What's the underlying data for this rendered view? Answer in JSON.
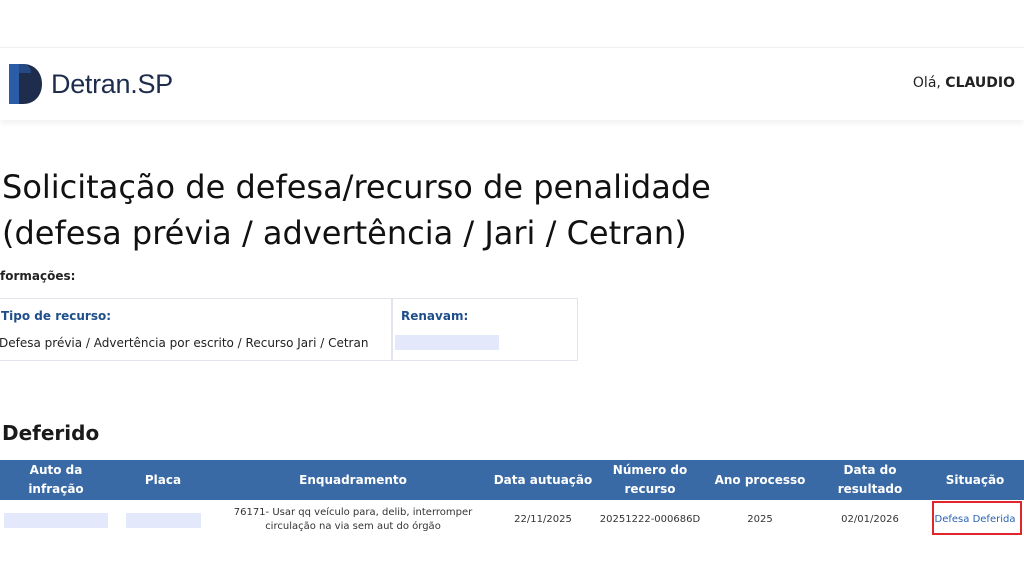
{
  "header": {
    "logo_name": "Detran",
    "logo_suffix": ".SP",
    "greeting_prefix": "Olá, ",
    "user_name": "CLAUDIO"
  },
  "page": {
    "title_line1": "Solicitação de defesa/recurso de penalidade",
    "title_line2": "(defesa prévia / advertência / Jari / Cetran)",
    "info_label": "formações:"
  },
  "info": {
    "tipo_label": "Tipo de recurso:",
    "tipo_value": "Defesa prévia / Advertência por escrito / Recurso Jari / Cetran",
    "renavam_label": "Renavam:"
  },
  "section": {
    "title": "Deferido"
  },
  "table": {
    "headers": {
      "auto": "Auto da infração",
      "placa": "Placa",
      "enquadramento": "Enquadramento",
      "data_autuacao": "Data autuação",
      "numero_recurso": "Número do recurso",
      "ano_processo": "Ano processo",
      "data_resultado": "Data do resultado",
      "situacao": "Situação"
    },
    "row": {
      "enquadramento": "76171- Usar qq veículo para, delib, interromper circulação na via sem aut do órgão",
      "data_autuacao": "22/11/2025",
      "numero_recurso": "20251222-000686D",
      "ano_processo": "2025",
      "data_resultado": "02/01/2026",
      "situacao": "Defesa Deferida"
    }
  },
  "colors": {
    "table_header_bg": "#3a6aa5",
    "brand_dark": "#1f2d4d",
    "brand_blue": "#2a5ca8",
    "link": "#2a63b3",
    "highlight": "#e0262d"
  },
  "icons": {
    "logo": "detran-d-logo-icon"
  }
}
